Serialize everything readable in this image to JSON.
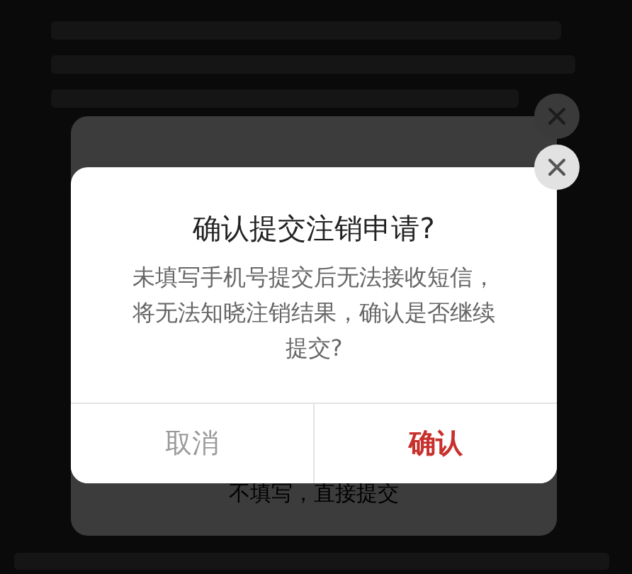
{
  "background_dialog": {
    "action_link": "不填写，直接提交"
  },
  "dialog": {
    "title": "确认提交注销申请?",
    "message": "未填写手机号提交后无法接收短信，将无法知晓注销结果，确认是否继续提交?",
    "buttons": [
      {
        "label": "取消",
        "kind": "cancel"
      },
      {
        "label": "确认",
        "kind": "confirm"
      }
    ]
  }
}
